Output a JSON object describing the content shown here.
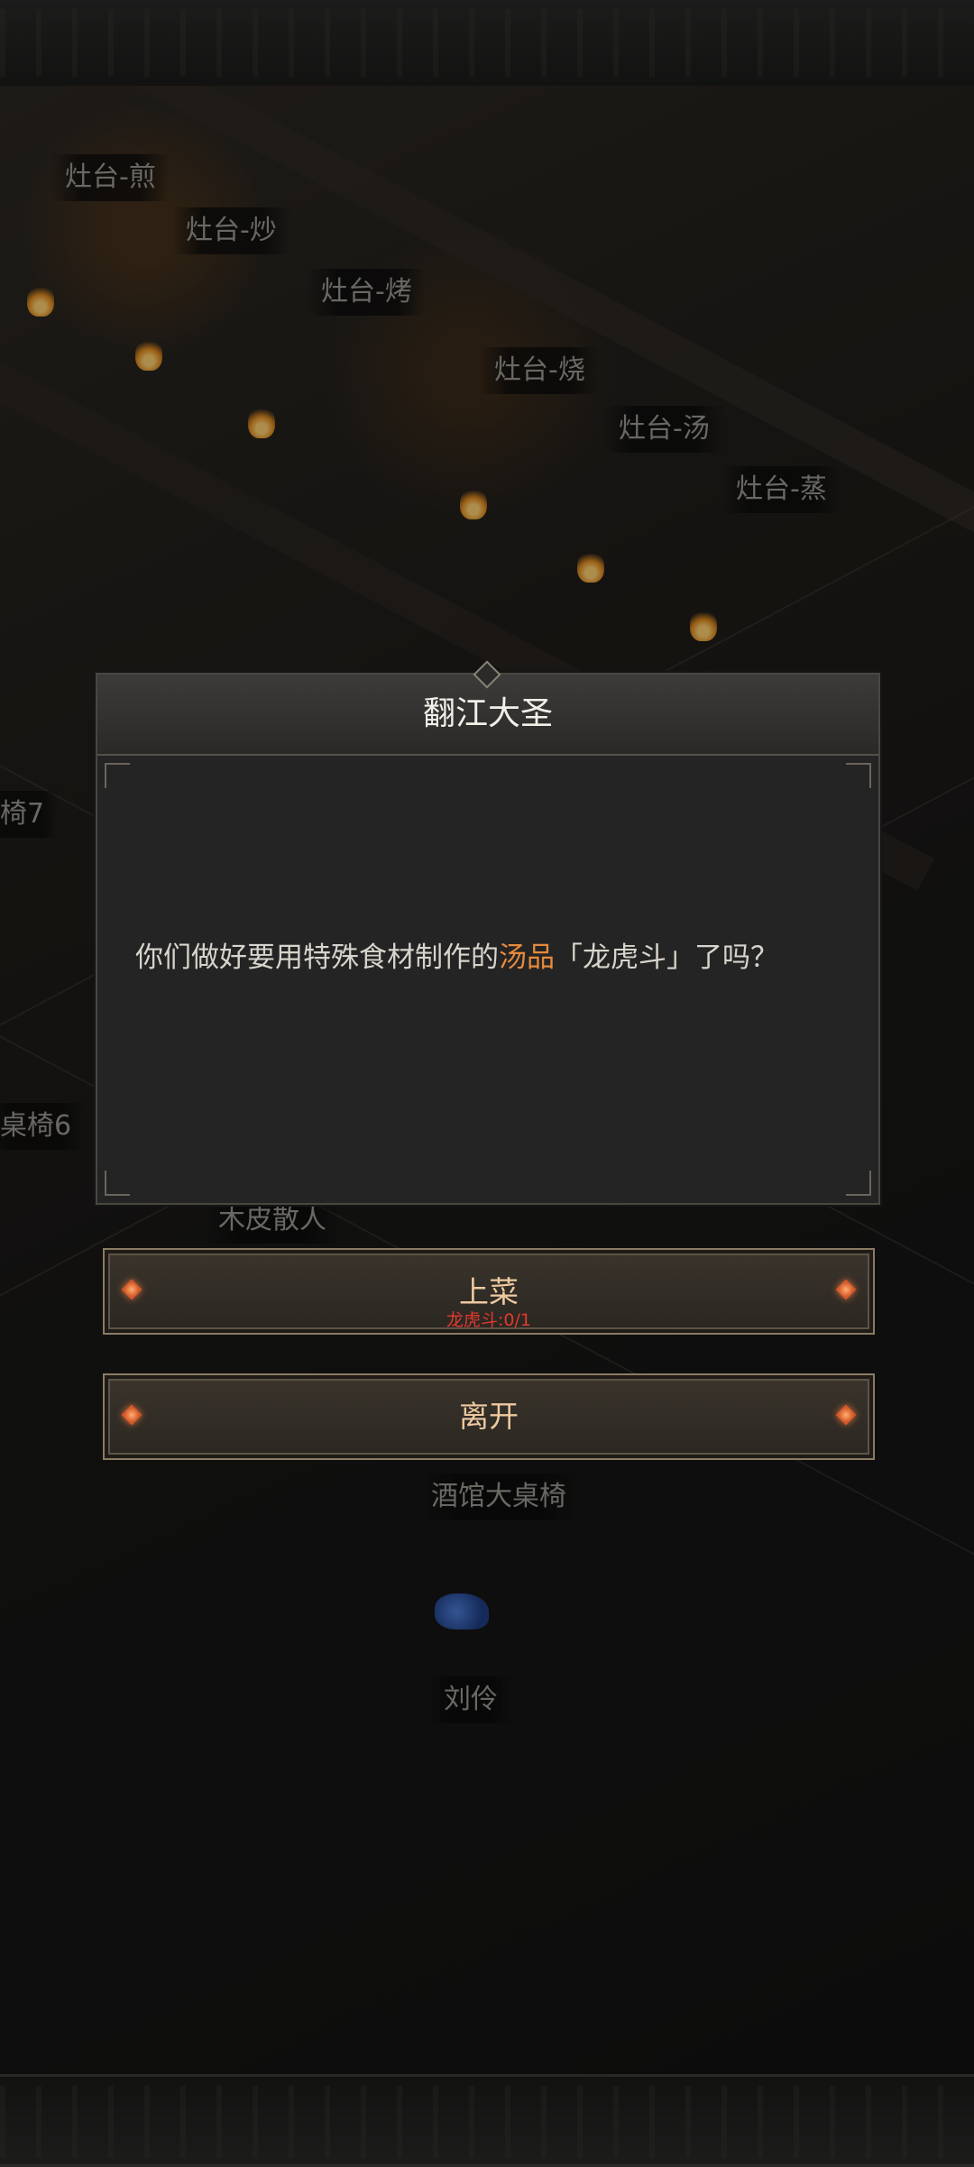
{
  "scene": {
    "station_labels": [
      "灶台-煎",
      "灶台-炒",
      "灶台-烤",
      "灶台-烧",
      "灶台-汤",
      "灶台-蒸"
    ],
    "table_labels": [
      "椅7",
      "桌椅6"
    ],
    "npc_labels": [
      "木皮散人",
      "刘伶"
    ],
    "area_label": "酒馆大桌椅"
  },
  "dialog": {
    "title": "翻江大圣",
    "text_before": "你们做好要用特殊食材制作的",
    "highlight": "汤品",
    "text_after": "「龙虎斗」了吗？"
  },
  "options": {
    "serve_label": "上菜",
    "serve_requirement": "龙虎斗:0/1",
    "leave_label": "离开"
  },
  "colors": {
    "highlight": "#e58a3d",
    "requirement": "#e23a2e",
    "button_text": "#eec9a0"
  }
}
